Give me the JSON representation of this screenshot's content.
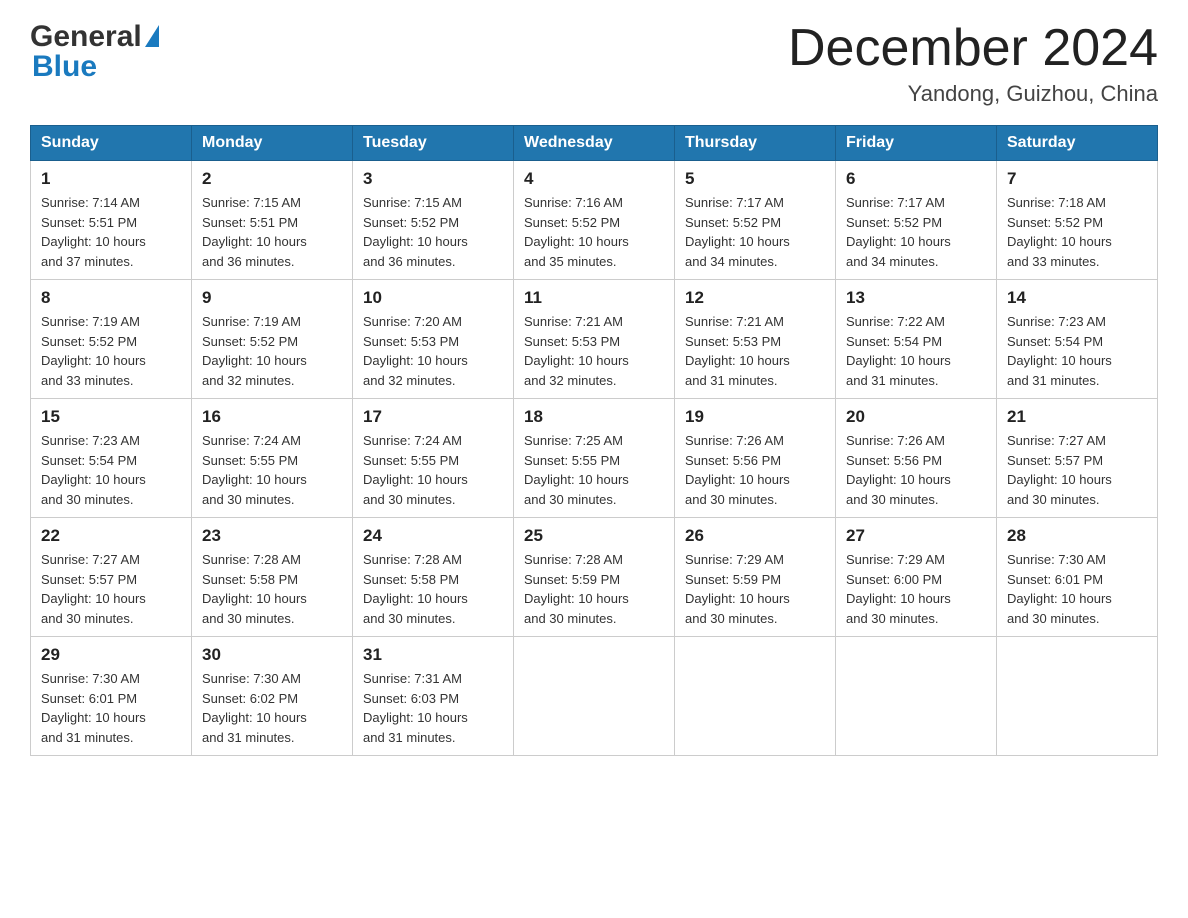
{
  "header": {
    "logo_general": "General",
    "logo_blue": "Blue",
    "month_title": "December 2024",
    "location": "Yandong, Guizhou, China"
  },
  "days_of_week": [
    "Sunday",
    "Monday",
    "Tuesday",
    "Wednesday",
    "Thursday",
    "Friday",
    "Saturday"
  ],
  "weeks": [
    [
      {
        "day": "1",
        "sunrise": "7:14 AM",
        "sunset": "5:51 PM",
        "daylight": "10 hours and 37 minutes."
      },
      {
        "day": "2",
        "sunrise": "7:15 AM",
        "sunset": "5:51 PM",
        "daylight": "10 hours and 36 minutes."
      },
      {
        "day": "3",
        "sunrise": "7:15 AM",
        "sunset": "5:52 PM",
        "daylight": "10 hours and 36 minutes."
      },
      {
        "day": "4",
        "sunrise": "7:16 AM",
        "sunset": "5:52 PM",
        "daylight": "10 hours and 35 minutes."
      },
      {
        "day": "5",
        "sunrise": "7:17 AM",
        "sunset": "5:52 PM",
        "daylight": "10 hours and 34 minutes."
      },
      {
        "day": "6",
        "sunrise": "7:17 AM",
        "sunset": "5:52 PM",
        "daylight": "10 hours and 34 minutes."
      },
      {
        "day": "7",
        "sunrise": "7:18 AM",
        "sunset": "5:52 PM",
        "daylight": "10 hours and 33 minutes."
      }
    ],
    [
      {
        "day": "8",
        "sunrise": "7:19 AM",
        "sunset": "5:52 PM",
        "daylight": "10 hours and 33 minutes."
      },
      {
        "day": "9",
        "sunrise": "7:19 AM",
        "sunset": "5:52 PM",
        "daylight": "10 hours and 32 minutes."
      },
      {
        "day": "10",
        "sunrise": "7:20 AM",
        "sunset": "5:53 PM",
        "daylight": "10 hours and 32 minutes."
      },
      {
        "day": "11",
        "sunrise": "7:21 AM",
        "sunset": "5:53 PM",
        "daylight": "10 hours and 32 minutes."
      },
      {
        "day": "12",
        "sunrise": "7:21 AM",
        "sunset": "5:53 PM",
        "daylight": "10 hours and 31 minutes."
      },
      {
        "day": "13",
        "sunrise": "7:22 AM",
        "sunset": "5:54 PM",
        "daylight": "10 hours and 31 minutes."
      },
      {
        "day": "14",
        "sunrise": "7:23 AM",
        "sunset": "5:54 PM",
        "daylight": "10 hours and 31 minutes."
      }
    ],
    [
      {
        "day": "15",
        "sunrise": "7:23 AM",
        "sunset": "5:54 PM",
        "daylight": "10 hours and 30 minutes."
      },
      {
        "day": "16",
        "sunrise": "7:24 AM",
        "sunset": "5:55 PM",
        "daylight": "10 hours and 30 minutes."
      },
      {
        "day": "17",
        "sunrise": "7:24 AM",
        "sunset": "5:55 PM",
        "daylight": "10 hours and 30 minutes."
      },
      {
        "day": "18",
        "sunrise": "7:25 AM",
        "sunset": "5:55 PM",
        "daylight": "10 hours and 30 minutes."
      },
      {
        "day": "19",
        "sunrise": "7:26 AM",
        "sunset": "5:56 PM",
        "daylight": "10 hours and 30 minutes."
      },
      {
        "day": "20",
        "sunrise": "7:26 AM",
        "sunset": "5:56 PM",
        "daylight": "10 hours and 30 minutes."
      },
      {
        "day": "21",
        "sunrise": "7:27 AM",
        "sunset": "5:57 PM",
        "daylight": "10 hours and 30 minutes."
      }
    ],
    [
      {
        "day": "22",
        "sunrise": "7:27 AM",
        "sunset": "5:57 PM",
        "daylight": "10 hours and 30 minutes."
      },
      {
        "day": "23",
        "sunrise": "7:28 AM",
        "sunset": "5:58 PM",
        "daylight": "10 hours and 30 minutes."
      },
      {
        "day": "24",
        "sunrise": "7:28 AM",
        "sunset": "5:58 PM",
        "daylight": "10 hours and 30 minutes."
      },
      {
        "day": "25",
        "sunrise": "7:28 AM",
        "sunset": "5:59 PM",
        "daylight": "10 hours and 30 minutes."
      },
      {
        "day": "26",
        "sunrise": "7:29 AM",
        "sunset": "5:59 PM",
        "daylight": "10 hours and 30 minutes."
      },
      {
        "day": "27",
        "sunrise": "7:29 AM",
        "sunset": "6:00 PM",
        "daylight": "10 hours and 30 minutes."
      },
      {
        "day": "28",
        "sunrise": "7:30 AM",
        "sunset": "6:01 PM",
        "daylight": "10 hours and 30 minutes."
      }
    ],
    [
      {
        "day": "29",
        "sunrise": "7:30 AM",
        "sunset": "6:01 PM",
        "daylight": "10 hours and 31 minutes."
      },
      {
        "day": "30",
        "sunrise": "7:30 AM",
        "sunset": "6:02 PM",
        "daylight": "10 hours and 31 minutes."
      },
      {
        "day": "31",
        "sunrise": "7:31 AM",
        "sunset": "6:03 PM",
        "daylight": "10 hours and 31 minutes."
      },
      null,
      null,
      null,
      null
    ]
  ],
  "labels": {
    "sunrise_prefix": "Sunrise: ",
    "sunset_prefix": "Sunset: ",
    "daylight_prefix": "Daylight: "
  }
}
